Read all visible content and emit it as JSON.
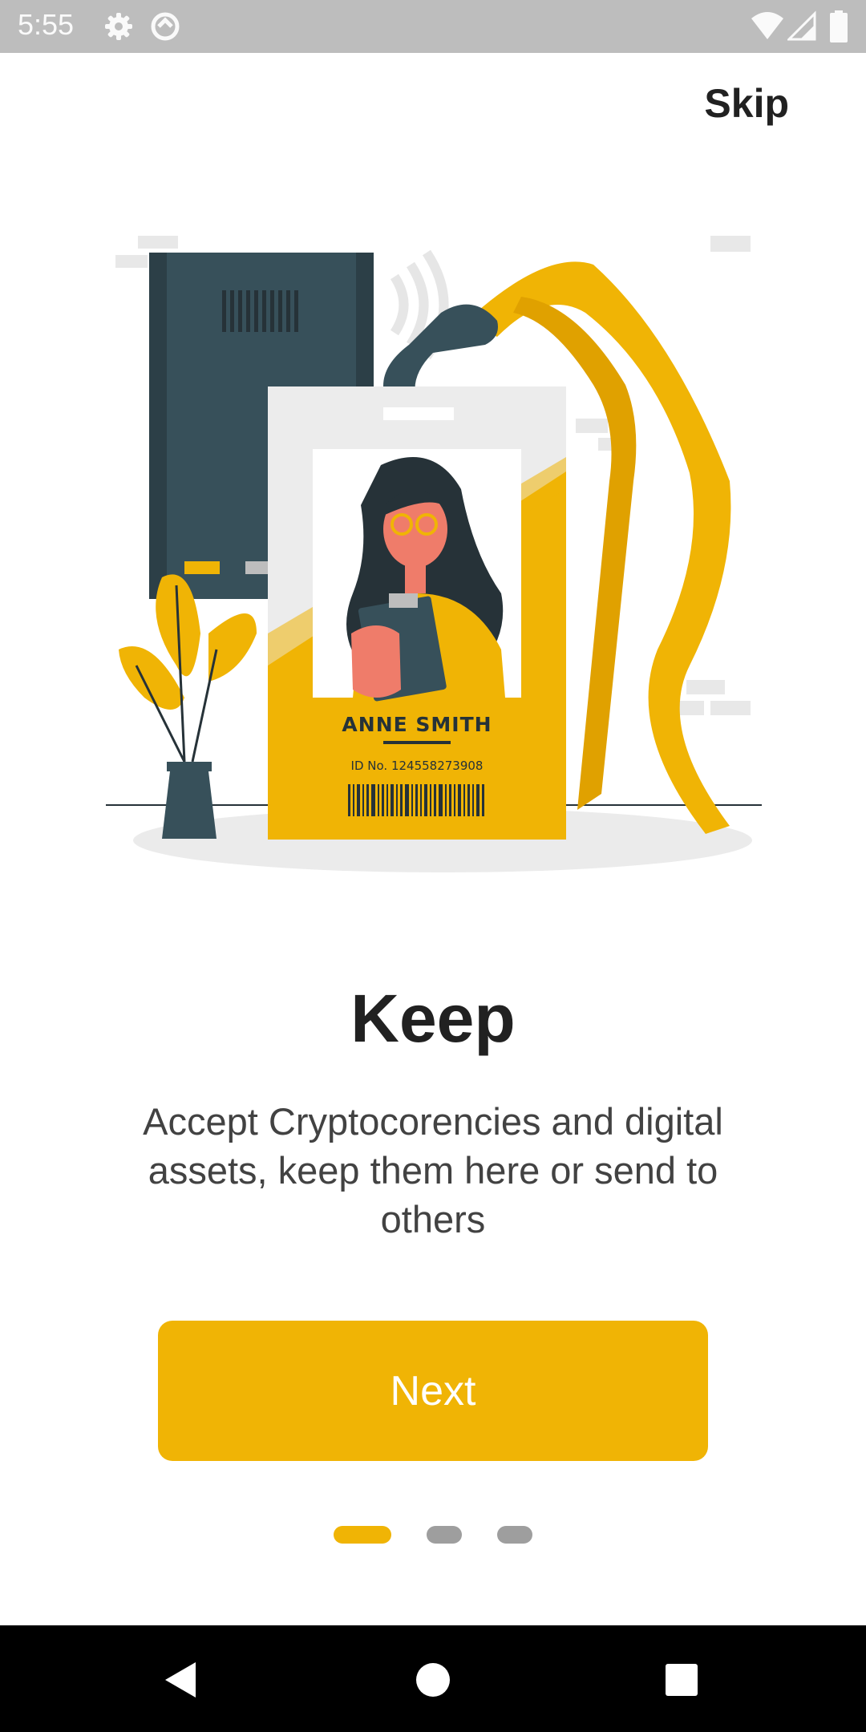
{
  "status_bar": {
    "time": "5:55",
    "icons": [
      "gear-icon",
      "sync-icon",
      "wifi-icon",
      "signal-icon",
      "battery-icon"
    ]
  },
  "header": {
    "skip_label": "Skip"
  },
  "illustration": {
    "badge_name": "ANNE SMITH",
    "badge_id": "ID No. 124558273908"
  },
  "onboarding": {
    "title": "Keep",
    "description": "Accept Cryptocorencies and digital assets, keep them here or send to others",
    "next_label": "Next",
    "page_index": 1,
    "page_count": 3
  },
  "colors": {
    "accent": "#f0b405",
    "dot_inactive": "#9e9e9e",
    "text_primary": "#212121",
    "status_bar_bg": "#bdbdbd"
  },
  "nav_bar": {
    "icons": [
      "back-icon",
      "home-icon",
      "recents-icon"
    ]
  }
}
